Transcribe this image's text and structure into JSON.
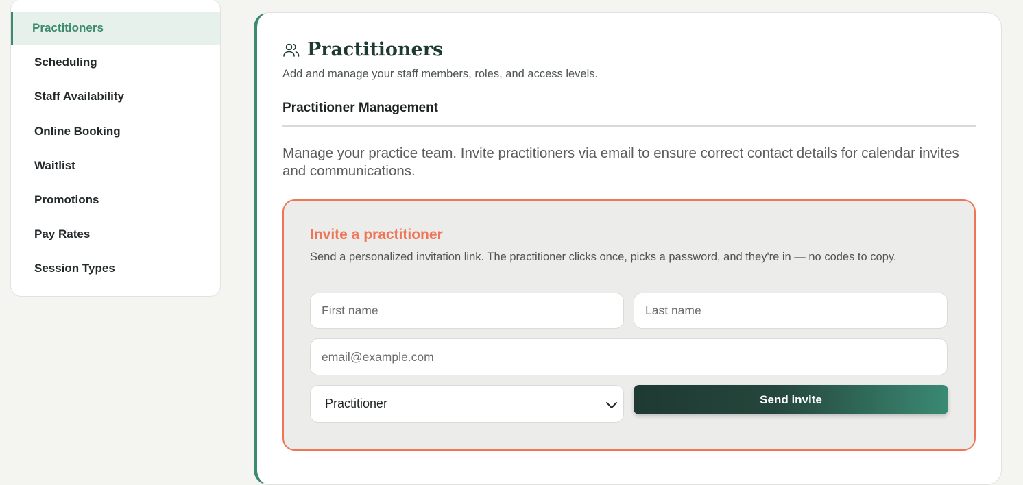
{
  "sidebar": {
    "items": [
      {
        "label": "Practitioners",
        "active": true
      },
      {
        "label": "Scheduling"
      },
      {
        "label": "Staff Availability"
      },
      {
        "label": "Online Booking"
      },
      {
        "label": "Waitlist"
      },
      {
        "label": "Promotions"
      },
      {
        "label": "Pay Rates"
      },
      {
        "label": "Session Types"
      }
    ]
  },
  "main": {
    "icon": "users-icon",
    "title": "Practitioners",
    "subtitle": "Add and manage your staff members, roles, and access levels.",
    "section_heading": "Practitioner Management",
    "description": "Manage your practice team. Invite practitioners via email to ensure correct contact details for calendar invites and communications."
  },
  "invite": {
    "title": "Invite a practitioner",
    "description": "Send a personalized invitation link. The practitioner clicks once, picks a password, and they're in — no codes to copy.",
    "first_name_placeholder": "First name",
    "last_name_placeholder": "Last name",
    "email_placeholder": "email@example.com",
    "role_selected": "Practitioner",
    "send_label": "Send invite"
  },
  "colors": {
    "accent_green": "#3c8a6f",
    "accent_orange": "#ee7657",
    "button_dark": "#1e3a32"
  }
}
